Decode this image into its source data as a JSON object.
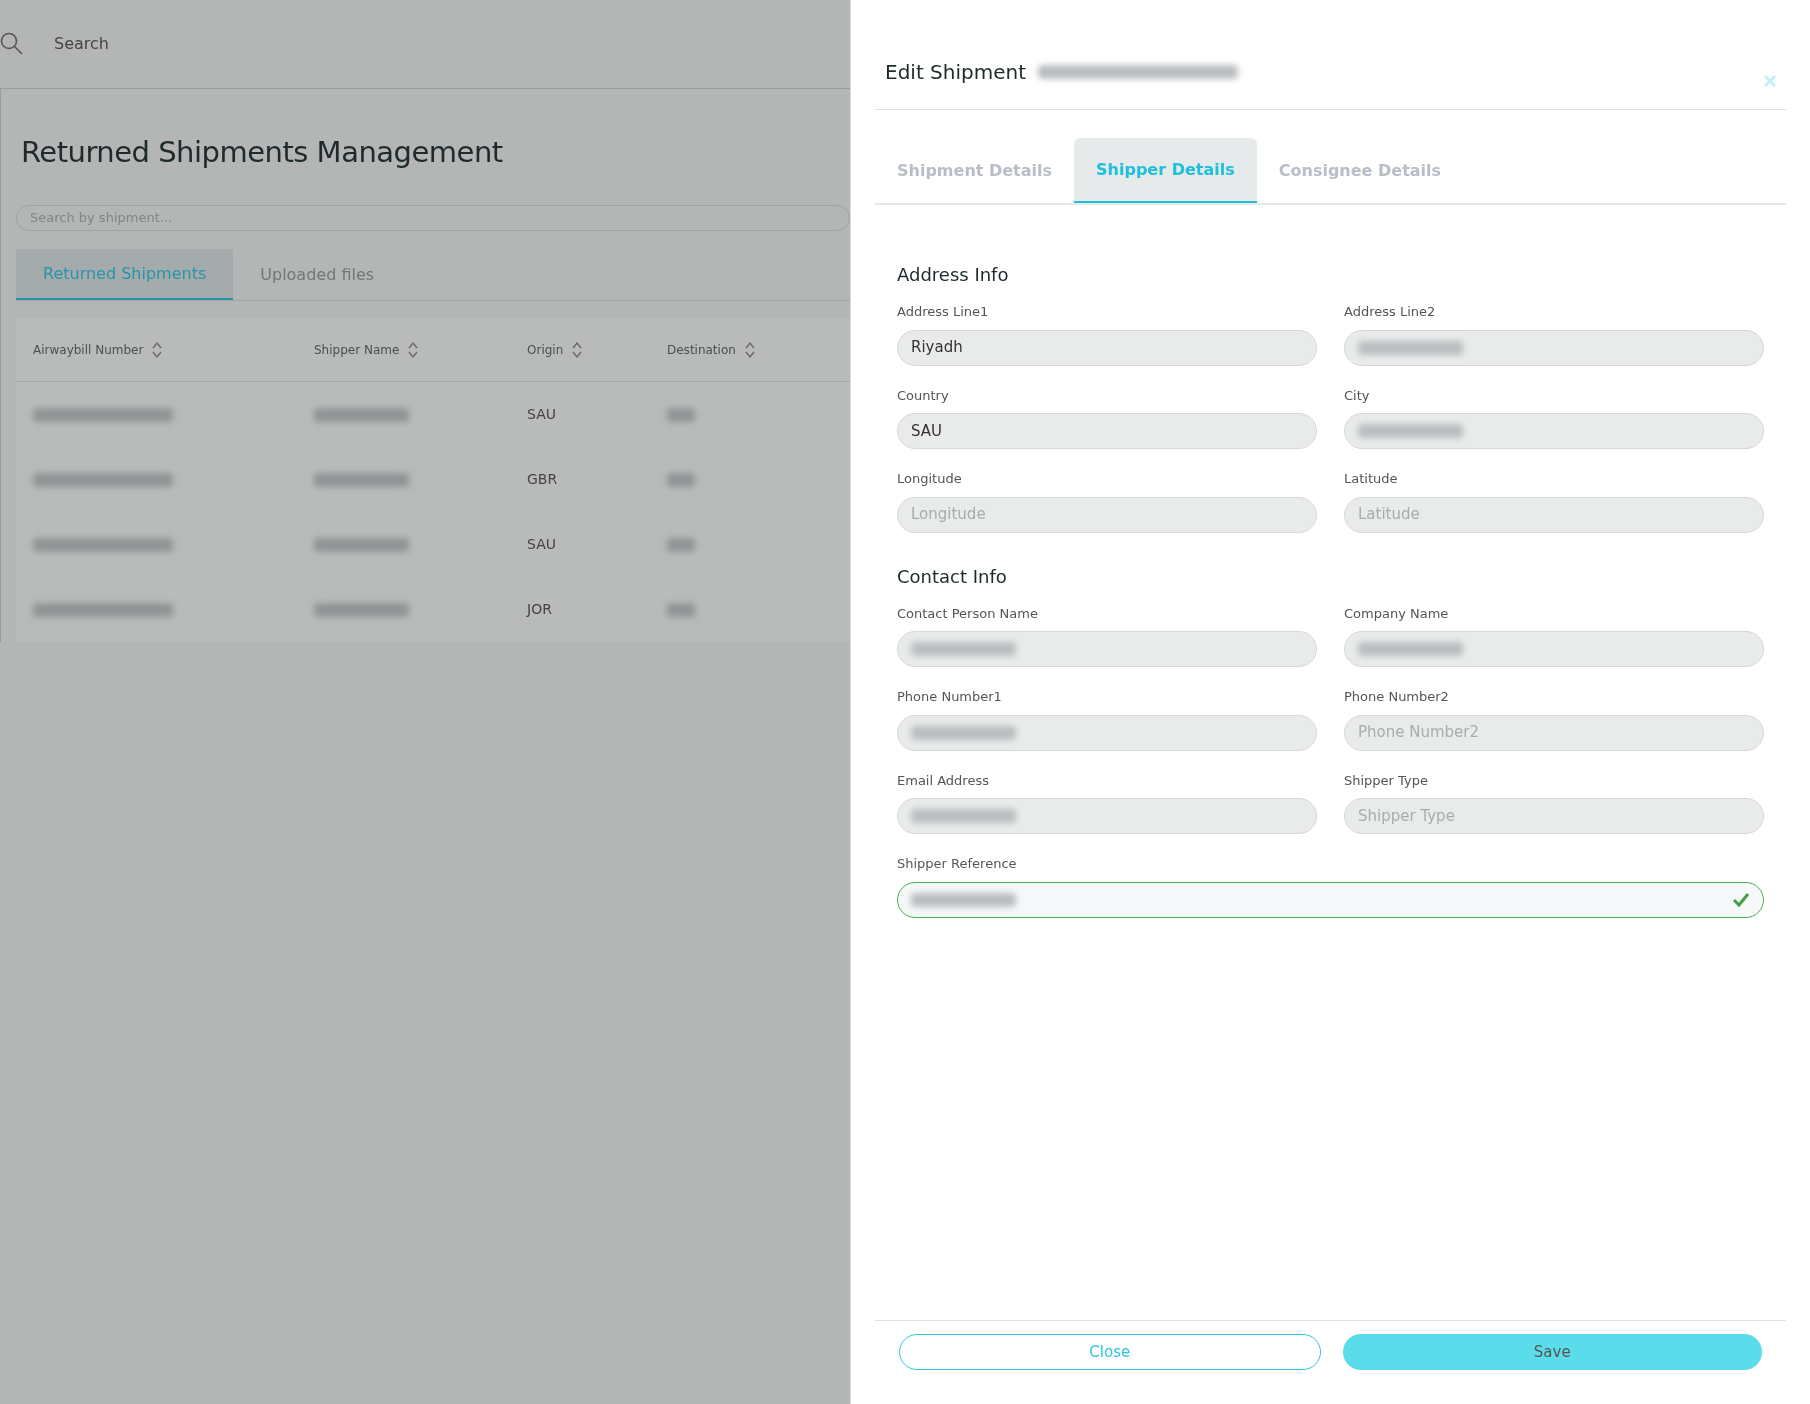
{
  "topbar": {
    "search_label": "Search"
  },
  "page": {
    "title": "Returned Shipments Management",
    "search": {
      "placeholder": "Search by shipment..."
    },
    "tabs": [
      {
        "label": "Returned Shipments",
        "selected": true
      },
      {
        "label": "Uploaded files",
        "selected": false
      }
    ],
    "table": {
      "columns": [
        "Airwaybill Number",
        "Shipper Name",
        "Origin",
        "Destination"
      ],
      "rows": [
        {
          "origin": "SAU"
        },
        {
          "origin": "GBR"
        },
        {
          "origin": "SAU"
        },
        {
          "origin": "JOR"
        }
      ]
    }
  },
  "modal": {
    "title": "Edit Shipment",
    "title_redacted": true,
    "tabs": [
      {
        "label": "Shipment Details",
        "selected": false
      },
      {
        "label": "Shipper Details",
        "selected": true
      },
      {
        "label": "Consignee Details",
        "selected": false
      }
    ],
    "sections": [
      {
        "title": "Address Info",
        "fields": [
          {
            "label": "Address Line1",
            "value": "Riyadh"
          },
          {
            "label": "Address Line2",
            "redacted": true
          },
          {
            "label": "Country",
            "value": "SAU"
          },
          {
            "label": "City",
            "redacted": true
          },
          {
            "label": "Longitude",
            "placeholder": "Longitude"
          },
          {
            "label": "Latitude",
            "placeholder": "Latitude"
          }
        ]
      },
      {
        "title": "Contact Info",
        "fields": [
          {
            "label": "Contact Person Name",
            "redacted": true
          },
          {
            "label": "Company Name",
            "redacted": true
          },
          {
            "label": "Phone Number1",
            "redacted": true
          },
          {
            "label": "Phone Number2",
            "placeholder": "Phone Number2"
          },
          {
            "label": "Email Address",
            "redacted": true
          },
          {
            "label": "Shipper Type",
            "placeholder": "Shipper Type"
          },
          {
            "label": "Shipper Reference",
            "redacted": true,
            "valid": true,
            "wide": true
          }
        ]
      }
    ],
    "buttons": [
      {
        "label": "Close",
        "kind": "outline"
      },
      {
        "label": "Save",
        "kind": "primary"
      }
    ]
  }
}
